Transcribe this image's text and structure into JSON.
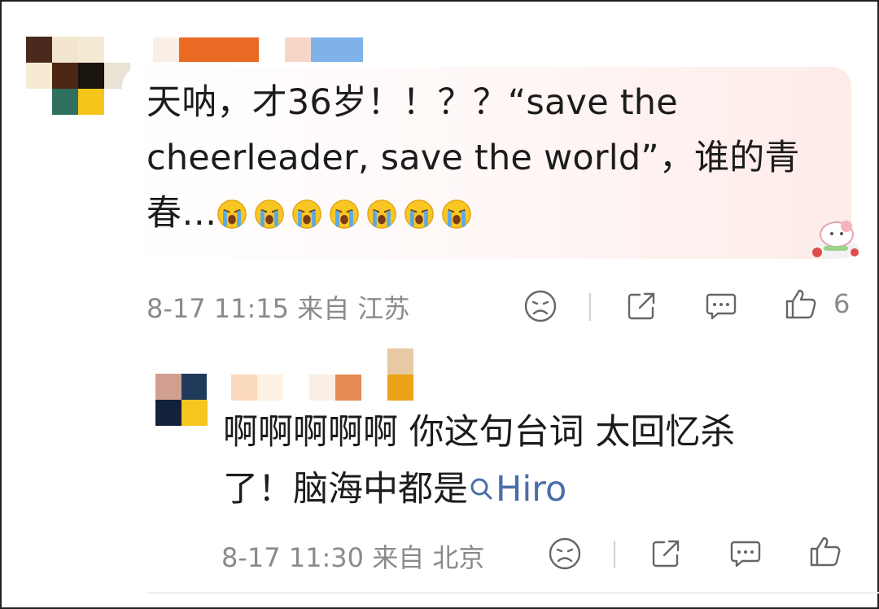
{
  "comment": {
    "text_line1": "天呐，才36岁！！？？“save the",
    "text_line2": "cheerleader, save the world”，谁的青",
    "text_line3": "春…",
    "emoji_count": 7,
    "emoji_icon": "crying-face-icon",
    "sticker_icon": "cartoon-sticker-icon",
    "timestamp": "8-17 11:15 来自 江苏",
    "likes": "6"
  },
  "reply": {
    "text_line1": "啊啊啊啊啊 你这句台词 太回忆杀",
    "text_line2_prefix": "了！脑海中都是",
    "mention": "Hiro",
    "mention_icon": "search-icon",
    "timestamp": "8-17 11:30 来自 北京"
  },
  "actions": [
    "dislike-icon",
    "share-icon",
    "comment-icon",
    "like-icon"
  ],
  "colors": {
    "text": "#1c1c1c",
    "meta": "#8a8a8a",
    "mention": "#4a6ea9",
    "bubble_tint": "#fdebe8"
  }
}
